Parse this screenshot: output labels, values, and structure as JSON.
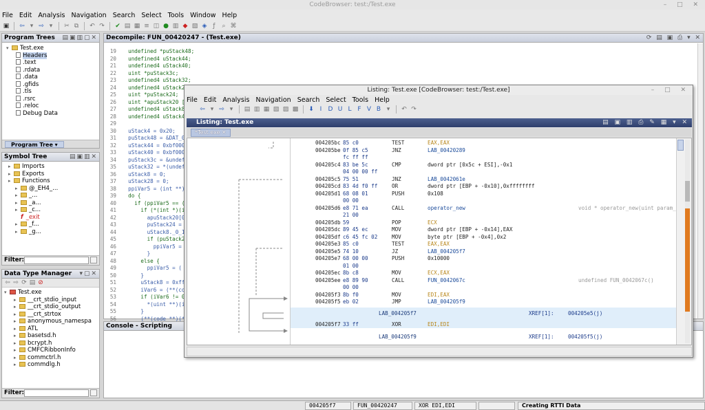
{
  "window": {
    "title": "CodeBrowser: test:/Test.exe"
  },
  "menu": [
    "File",
    "Edit",
    "Analysis",
    "Navigation",
    "Search",
    "Select",
    "Tools",
    "Window",
    "Help"
  ],
  "program_trees": {
    "title": "Program Trees",
    "root": "Test.exe",
    "items": [
      "Headers",
      ".text",
      ".rdata",
      ".data",
      ".gfids",
      ".tls",
      ".rsrc",
      ".reloc",
      "Debug Data"
    ],
    "tab": "Program Tree"
  },
  "symbol_tree": {
    "title": "Symbol Tree",
    "items": [
      {
        "label": "Imports",
        "indent": 1,
        "type": "folder"
      },
      {
        "label": "Exports",
        "indent": 1,
        "type": "folder"
      },
      {
        "label": "Functions",
        "indent": 1,
        "type": "folder"
      },
      {
        "label": "@_EH4_...",
        "indent": 2,
        "type": "folder"
      },
      {
        "label": "_...",
        "indent": 2,
        "type": "folder"
      },
      {
        "label": "_a...",
        "indent": 2,
        "type": "folder"
      },
      {
        "label": "_c...",
        "indent": 2,
        "type": "folder"
      },
      {
        "label": "_exit",
        "indent": 2,
        "type": "func"
      },
      {
        "label": "_f...",
        "indent": 2,
        "type": "folder"
      },
      {
        "label": "_g...",
        "indent": 2,
        "type": "folder"
      }
    ],
    "filter_label": "Filter:"
  },
  "data_type_manager": {
    "title": "Data Type Manager",
    "root": "Test.exe",
    "items": [
      "__crt_stdio_input",
      "__crt_stdio_output",
      "__crt_strtox",
      "anonymous_namespa",
      "ATL",
      "basetsd.h",
      "bcrypt.h",
      "CMFCRibbonInfo",
      "commctrl.h",
      "commdlg.h"
    ],
    "filter_label": "Filter:"
  },
  "decompile": {
    "title": "Decompile: FUN_00420247 - (Test.exe)",
    "lines": [
      {
        "n": "19",
        "t": "  undefined *puStack48;"
      },
      {
        "n": "20",
        "t": "  undefined4 uStack44;"
      },
      {
        "n": "21",
        "t": "  undefined4 uStack40;"
      },
      {
        "n": "22",
        "t": "  uint *puStack3c;"
      },
      {
        "n": "23",
        "t": "  undefined4 uStack32;"
      },
      {
        "n": "24",
        "t": "  undefined4 uStack28"
      },
      {
        "n": "25",
        "t": "  uint *puStack24;"
      },
      {
        "n": "26",
        "t": "  uint *apuStack20 [1"
      },
      {
        "n": "27",
        "t": "  undefined4 uStack8;"
      },
      {
        "n": "28",
        "t": "  undefined4 uStack4;"
      },
      {
        "n": "29",
        "t": ""
      },
      {
        "n": "30",
        "t": "  uStack4 = 0x20;"
      },
      {
        "n": "31",
        "t": "  puStack48 = &DAT_00"
      },
      {
        "n": "32",
        "t": "  uStack44 = 0xbf0000"
      },
      {
        "n": "33",
        "t": "  uStack40 = 0xbf0000"
      },
      {
        "n": "34",
        "t": "  puStack3c = &undefi"
      },
      {
        "n": "35",
        "t": "  uStack32 = *(undefi"
      },
      {
        "n": "36",
        "t": "  uStack8 = 0;"
      },
      {
        "n": "37",
        "t": "  uStack28 = 0;"
      },
      {
        "n": "38",
        "t": "  ppiVar5 = (int **)P"
      },
      {
        "n": "39",
        "t": "  do {"
      },
      {
        "n": "40",
        "t": "    if (ppiVar5 == (i"
      },
      {
        "n": "41",
        "t": "      if (*(int *)(iP"
      },
      {
        "n": "42",
        "t": "        apuStack20[0]"
      },
      {
        "n": "43",
        "t": "        puStack24 = ("
      },
      {
        "n": "44",
        "t": "        uStack8._0_1_"
      },
      {
        "n": "45",
        "t": "        if (puStack24"
      },
      {
        "n": "46",
        "t": "          ppiVar5 = ("
      },
      {
        "n": "47",
        "t": "        }"
      },
      {
        "n": "48",
        "t": "      else {"
      },
      {
        "n": "49",
        "t": "        ppiVar5 = ("
      },
      {
        "n": "50",
        "t": "      }"
      },
      {
        "n": "51",
        "t": "      uStack8 = 0xffff"
      },
      {
        "n": "52",
        "t": "      iVar6 = (**(co"
      },
      {
        "n": "53",
        "t": "      if (iVar6 != 0"
      },
      {
        "n": "54",
        "t": "        *(uint **)(i"
      },
      {
        "n": "55",
        "t": "      }"
      },
      {
        "n": "56",
        "t": "      (**(code **)(*"
      }
    ]
  },
  "console": {
    "title": "Console - Scripting"
  },
  "listing": {
    "window_title": "Listing: Test.exe [CodeBrowser: test:/Test.exe]",
    "menu": [
      "File",
      "Edit",
      "Analysis",
      "Navigation",
      "Search",
      "Select",
      "Tools",
      "Help"
    ],
    "inner_title": "Listing: Test.exe",
    "tab": "*Test.exe",
    "rows": [
      {
        "a": "004205bc",
        "b": "85 c0",
        "m": "TEST",
        "o": "EAX,EAX",
        "c": ""
      },
      {
        "a": "004205be",
        "b": "0f 85 c5",
        "m": "JNZ",
        "o": "LAB_00420289",
        "c": ""
      },
      {
        "a": "",
        "b": "fc ff ff",
        "m": "",
        "o": "",
        "c": ""
      },
      {
        "a": "004205c4",
        "b": "83 be 5c",
        "m": "CMP",
        "o": "dword ptr [0x5c + ESI],-0x1",
        "c": ""
      },
      {
        "a": "",
        "b": "04 00 00 ff",
        "m": "",
        "o": "",
        "c": ""
      },
      {
        "a": "004205c5",
        "b": "75 51",
        "m": "JNZ",
        "o": "LAB_0042061e",
        "c": ""
      },
      {
        "a": "004205cd",
        "b": "83 4d f0 ff",
        "m": "OR",
        "o": "dword ptr [EBP + -0x10],0xffffffff",
        "c": ""
      },
      {
        "a": "004205d1",
        "b": "68 08 01",
        "m": "PUSH",
        "o": "0x108",
        "c": ""
      },
      {
        "a": "",
        "b": "00 00",
        "m": "",
        "o": "",
        "c": ""
      },
      {
        "a": "004205d6",
        "b": "e8 71 ea",
        "m": "CALL",
        "o": "operator_new",
        "c": "void * operator_new(uint param_"
      },
      {
        "a": "",
        "b": "21 00",
        "m": "",
        "o": "",
        "c": ""
      },
      {
        "a": "004205db",
        "b": "59",
        "m": "POP",
        "o": "ECX",
        "c": ""
      },
      {
        "a": "004205dc",
        "b": "89 45 ec",
        "m": "MOV",
        "o": "dword ptr [EBP + -0x14],EAX",
        "c": ""
      },
      {
        "a": "004205df",
        "b": "c6 45 fc 02",
        "m": "MOV",
        "o": "byte ptr [EBP + -0x4],0x2",
        "c": ""
      },
      {
        "a": "004205e3",
        "b": "85 c0",
        "m": "TEST",
        "o": "EAX,EAX",
        "c": ""
      },
      {
        "a": "004205e5",
        "b": "74 10",
        "m": "JZ",
        "o": "LAB_004205f7",
        "c": ""
      },
      {
        "a": "004205e7",
        "b": "68 00 00",
        "m": "PUSH",
        "o": "0x10000",
        "c": ""
      },
      {
        "a": "",
        "b": "01 00",
        "m": "",
        "o": "",
        "c": ""
      },
      {
        "a": "004205ec",
        "b": "8b c8",
        "m": "MOV",
        "o": "ECX,EAX",
        "c": ""
      },
      {
        "a": "004205ee",
        "b": "e8 89 90",
        "m": "CALL",
        "o": "FUN_0042067c",
        "c": "undefined FUN_0042067c()"
      },
      {
        "a": "",
        "b": "00 00",
        "m": "",
        "o": "",
        "c": ""
      },
      {
        "a": "004205f3",
        "b": "8b f0",
        "m": "MOV",
        "o": "EDI,EAX",
        "c": ""
      },
      {
        "a": "004205f5",
        "b": "eb 02",
        "m": "JMP",
        "o": "LAB_004205f9",
        "c": ""
      }
    ],
    "label1": {
      "name": "LAB_004205f7",
      "xref": "XREF[1]:",
      "xaddr": "004205e5(j)"
    },
    "row_after": {
      "a": "004205f7",
      "b": "33 ff",
      "m": "XOR",
      "o": "EDI,EDI"
    },
    "label2": {
      "name": "LAB_004205f9",
      "xref": "XREF[1]:",
      "xaddr": "004205f5(j)"
    }
  },
  "status": {
    "address": "004205f7",
    "function": "FUN_00420247",
    "instruction": "XOR EDI,EDI",
    "task": "Creating RTTI Data"
  }
}
